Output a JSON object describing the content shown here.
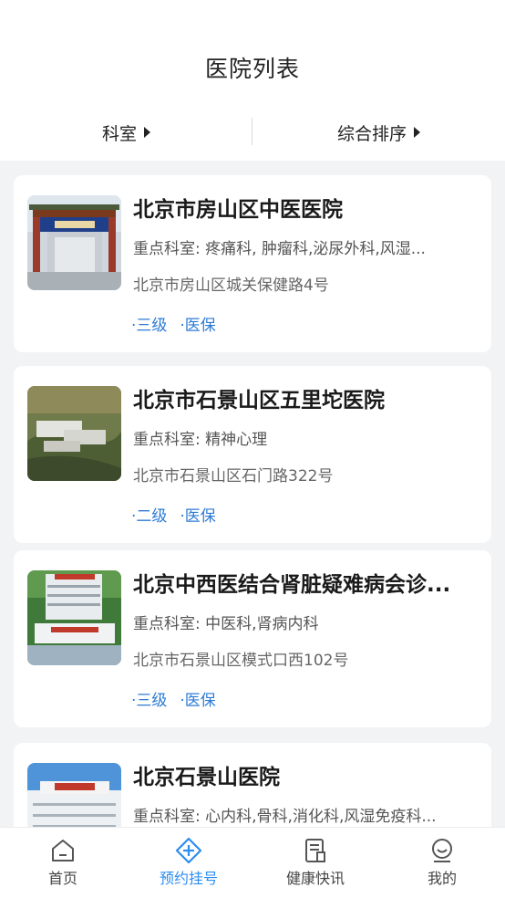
{
  "header": {
    "title": "医院列表"
  },
  "filters": {
    "department": "科室",
    "sort": "综合排序"
  },
  "hospitals": [
    {
      "name": "北京市房山区中医医院",
      "departments": "重点科室: 疼痛科, 肿瘤科,泌尿外科,风湿...",
      "address": "北京市房山区城关保健路4号",
      "level": "·三级",
      "insurance": "·医保",
      "thumb": "gate"
    },
    {
      "name": "北京市石景山区五里坨医院",
      "departments": "重点科室: 精神心理",
      "address": "北京市石景山区石门路322号",
      "level": "·二级",
      "insurance": "·医保",
      "thumb": "aerial"
    },
    {
      "name": "北京中西医结合肾脏疑难病会诊...",
      "departments": "重点科室: 中医科,肾病内科",
      "address": "北京市石景山区模式口西102号",
      "level": "·三级",
      "insurance": "·医保",
      "thumb": "building-red-sign"
    },
    {
      "name": "北京石景山医院",
      "departments": "重点科室: 心内科,骨科,消化科,风湿免疫科...",
      "address": "",
      "level": "",
      "insurance": "",
      "thumb": "building-sky"
    }
  ],
  "tabbar": {
    "items": [
      {
        "label": "首页",
        "icon": "home-icon",
        "active": false
      },
      {
        "label": "预约挂号",
        "icon": "register-icon",
        "active": true
      },
      {
        "label": "健康快讯",
        "icon": "news-icon",
        "active": false
      },
      {
        "label": "我的",
        "icon": "profile-icon",
        "active": false
      }
    ],
    "active_color": "#2d8cf0",
    "inactive_color": "#444444"
  }
}
